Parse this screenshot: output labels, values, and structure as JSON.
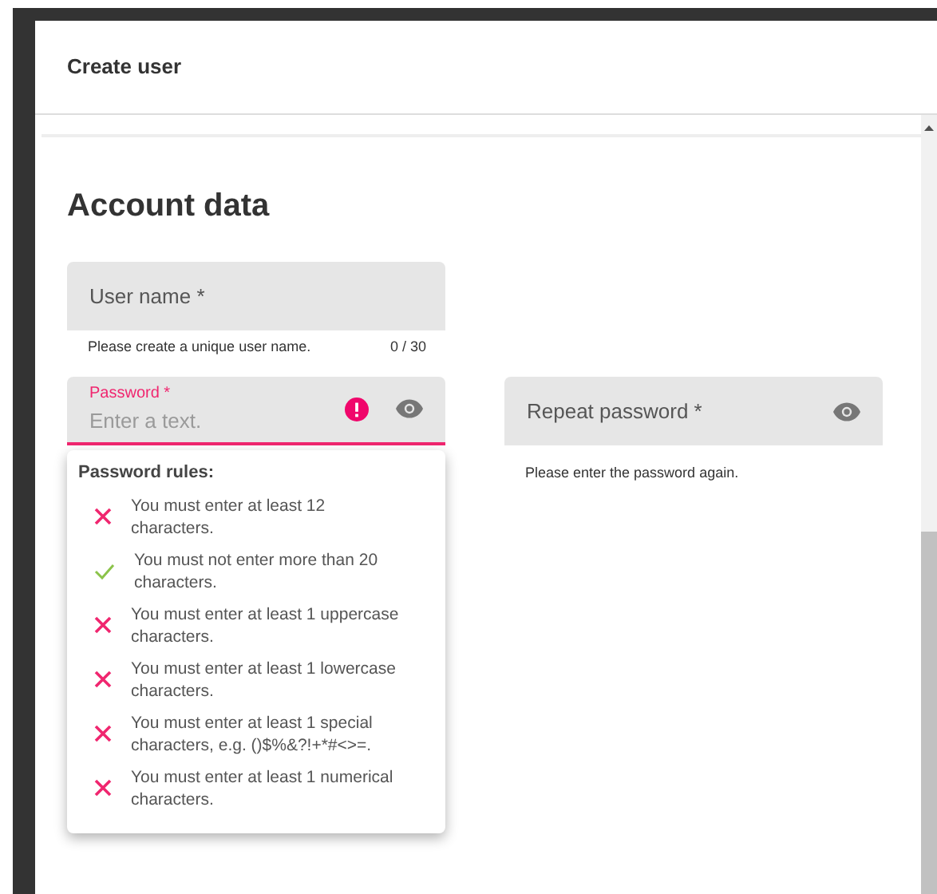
{
  "dialog": {
    "title": "Create user"
  },
  "section": {
    "title": "Account data"
  },
  "username": {
    "label": "User name *",
    "hint": "Please create a unique user name.",
    "counter": "0 / 30"
  },
  "password": {
    "label": "Password *",
    "placeholder": "Enter a text.",
    "invalid": true
  },
  "repeat_password": {
    "label": "Repeat password *",
    "hint": "Please enter the password again."
  },
  "password_rules": {
    "title": "Password rules:",
    "rules": [
      {
        "text": "You must enter at least 12 characters.",
        "passed": false
      },
      {
        "text": "You must not enter more than 20 characters.",
        "passed": true
      },
      {
        "text": "You must enter at least 1 uppercase characters.",
        "passed": false
      },
      {
        "text": "You must enter at least 1 lowercase characters.",
        "passed": false
      },
      {
        "text": "You must enter at least 1 special characters, e.g. ()$%&?!+*#<>=.",
        "passed": false
      },
      {
        "text": "You must enter at least 1 numerical characters.",
        "passed": false
      }
    ]
  }
}
